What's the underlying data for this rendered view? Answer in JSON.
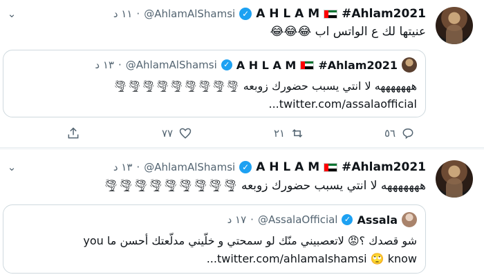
{
  "tweet1": {
    "name": "A H L A M",
    "hashtag": "#Ahlam2021",
    "handle": "@AhlamAlShamsi",
    "dot": "·",
    "time": "١١ د",
    "text": "عنيتها لك ع الواتس اب",
    "emoji": "😂😂😂",
    "quote": {
      "name": "A H L A M",
      "hashtag": "#Ahlam2021",
      "handle": "@AhlamAlShamsi",
      "dot": "·",
      "time": "١٣ د",
      "line1": "هههههههه لا انتي يسبب حضورك زوبعه",
      "tornadoes": "🌪🌪🌪🌪🌪🌪🌪🌪🌪",
      "line2": "twitter.com/assalaofficial..."
    },
    "actions": {
      "reply_count": "٥٦",
      "retweet_count": "٢١",
      "like_count": "٧٧"
    }
  },
  "tweet2": {
    "name": "A H L A M",
    "hashtag": "#Ahlam2021",
    "handle": "@AhlamAlShamsi",
    "dot": "·",
    "time": "١٣ د",
    "text": "هههههههه لا انتي يسبب حضورك زوبعه",
    "tornadoes": "🌪🌪🌪🌪🌪🌪🌪🌪🌪",
    "quote": {
      "name": "Assala",
      "handle": "@AssalaOfficial",
      "dot": "·",
      "time": "١٧ د",
      "line1": "شو قصدك ؟😡 لاتعصبيني منّك لو سمحتي و خلّيني مدلّعتك أحسن ما you",
      "line2_link": "twitter.com/ahlamalshamsi",
      "line2_rest": "🙄 know..."
    }
  },
  "icons": {
    "caret": "chevron-down-icon",
    "reply": "reply-icon",
    "retweet": "retweet-icon",
    "like": "heart-icon",
    "share": "share-icon"
  },
  "colors": {
    "verified": "#1da1f2",
    "secondary_text": "#536471",
    "border": "#cfd9de"
  }
}
